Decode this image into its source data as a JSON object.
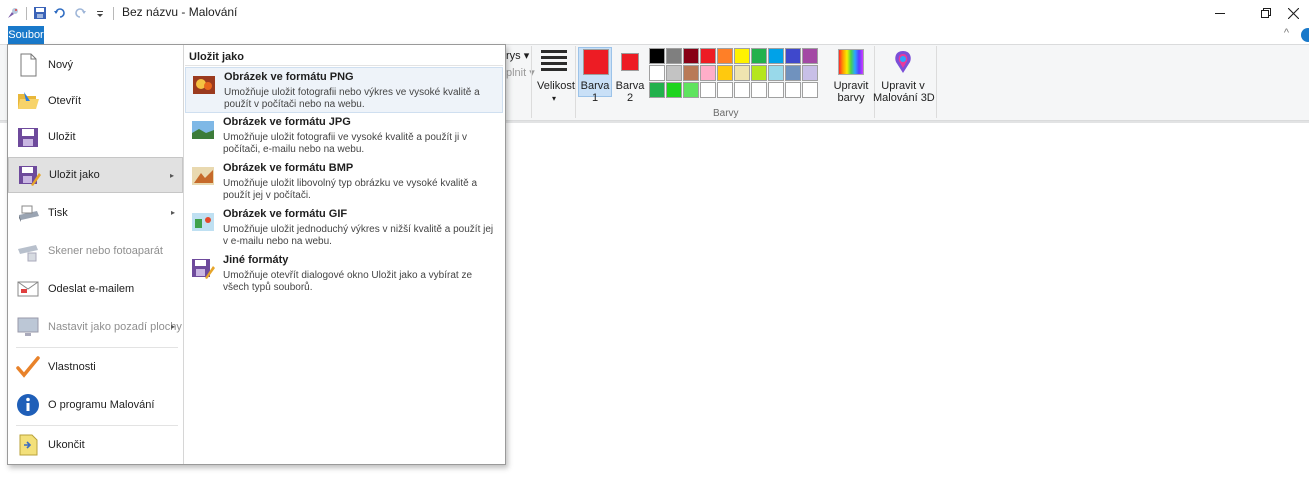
{
  "window": {
    "title": "Bez názvu - Malování",
    "controls": [
      "minimize",
      "maximize",
      "close"
    ]
  },
  "quick_access": {
    "icons": [
      "paint-app-icon",
      "save-icon",
      "undo-icon",
      "redo-icon",
      "customize-qat-icon"
    ]
  },
  "ribbon": {
    "file_tab": "Soubor",
    "partial_labels": {
      "obrysy": "rys ▾",
      "vyplnit": "plnit ▾"
    },
    "velikost_label": "Velikost",
    "velikost_arrow": "▾",
    "barva1_label": "Barva\n1",
    "barva2_label": "Barva\n2",
    "upravit_barvy_label": "Upravit\nbarvy",
    "upravit_3d_label": "Upravit v\nMalování 3D",
    "barvy_group": "Barvy",
    "barva1_color": "#ed1c24",
    "barva2_color": "#ed1c24",
    "palette": [
      "#000000",
      "#7f7f7f",
      "#880015",
      "#ed1c24",
      "#ff7f27",
      "#fff200",
      "#22b14c",
      "#00a2e8",
      "#3f48cc",
      "#a349a4",
      "#ffffff",
      "#c3c3c3",
      "#b97a57",
      "#ffaec9",
      "#ffc90e",
      "#efe4b0",
      "#b5e61d",
      "#99d9ea",
      "#7092be",
      "#c8bfe7",
      "#22b14c",
      "#1ed41e",
      "#5fe35f",
      "#ffffff",
      "#ffffff",
      "#ffffff",
      "#ffffff",
      "#ffffff",
      "#ffffff",
      "#ffffff"
    ]
  },
  "file_menu": {
    "items": [
      {
        "label": "Nový",
        "icon": "new-document-icon",
        "disabled": false,
        "submenu": false
      },
      {
        "label": "Otevřít",
        "icon": "open-folder-icon",
        "disabled": false,
        "submenu": false
      },
      {
        "label": "Uložit",
        "icon": "save-icon",
        "disabled": false,
        "submenu": false
      },
      {
        "label": "Uložit jako",
        "icon": "save-as-icon",
        "disabled": false,
        "submenu": true
      },
      {
        "label": "Tisk",
        "icon": "printer-icon",
        "disabled": false,
        "submenu": true
      },
      {
        "label": "Skener nebo fotoaparát",
        "icon": "scanner-icon",
        "disabled": true,
        "submenu": false
      },
      {
        "label": "Odeslat e-mailem",
        "icon": "email-icon",
        "disabled": false,
        "submenu": false
      },
      {
        "label": "Nastavit jako pozadí plochy",
        "icon": "desktop-background-icon",
        "disabled": true,
        "submenu": true
      },
      {
        "label": "Vlastnosti",
        "icon": "checkmark-icon",
        "disabled": false,
        "submenu": false
      },
      {
        "label": "O programu Malování",
        "icon": "info-icon",
        "disabled": false,
        "submenu": false
      },
      {
        "label": "Ukončit",
        "icon": "exit-icon",
        "disabled": false,
        "submenu": false
      }
    ],
    "submenu_arrow": "▸",
    "submenu": {
      "title": "Uložit jako",
      "items": [
        {
          "title": "Obrázek ve formátu PNG",
          "desc": "Umožňuje uložit fotografii nebo výkres ve vysoké kvalitě a použít v počítači nebo na webu.",
          "icon": "png-image-icon"
        },
        {
          "title": "Obrázek ve formátu JPG",
          "desc": "Umožňuje uložit fotografii ve vysoké kvalitě a použít ji v počítači, e-mailu nebo na webu.",
          "icon": "jpg-image-icon"
        },
        {
          "title": "Obrázek ve formátu BMP",
          "desc": "Umožňuje uložit libovolný typ obrázku ve vysoké kvalitě a použít jej v počítači.",
          "icon": "bmp-image-icon"
        },
        {
          "title": "Obrázek ve formátu GIF",
          "desc": "Umožňuje uložit jednoduchý výkres v nižší kvalitě a použít jej v e-mailu nebo na webu.",
          "icon": "gif-image-icon"
        },
        {
          "title": "Jiné formáty",
          "desc": "Umožňuje otevřít dialogové okno Uložit jako a vybírat ze všech typů souborů.",
          "icon": "other-formats-icon"
        }
      ]
    }
  }
}
